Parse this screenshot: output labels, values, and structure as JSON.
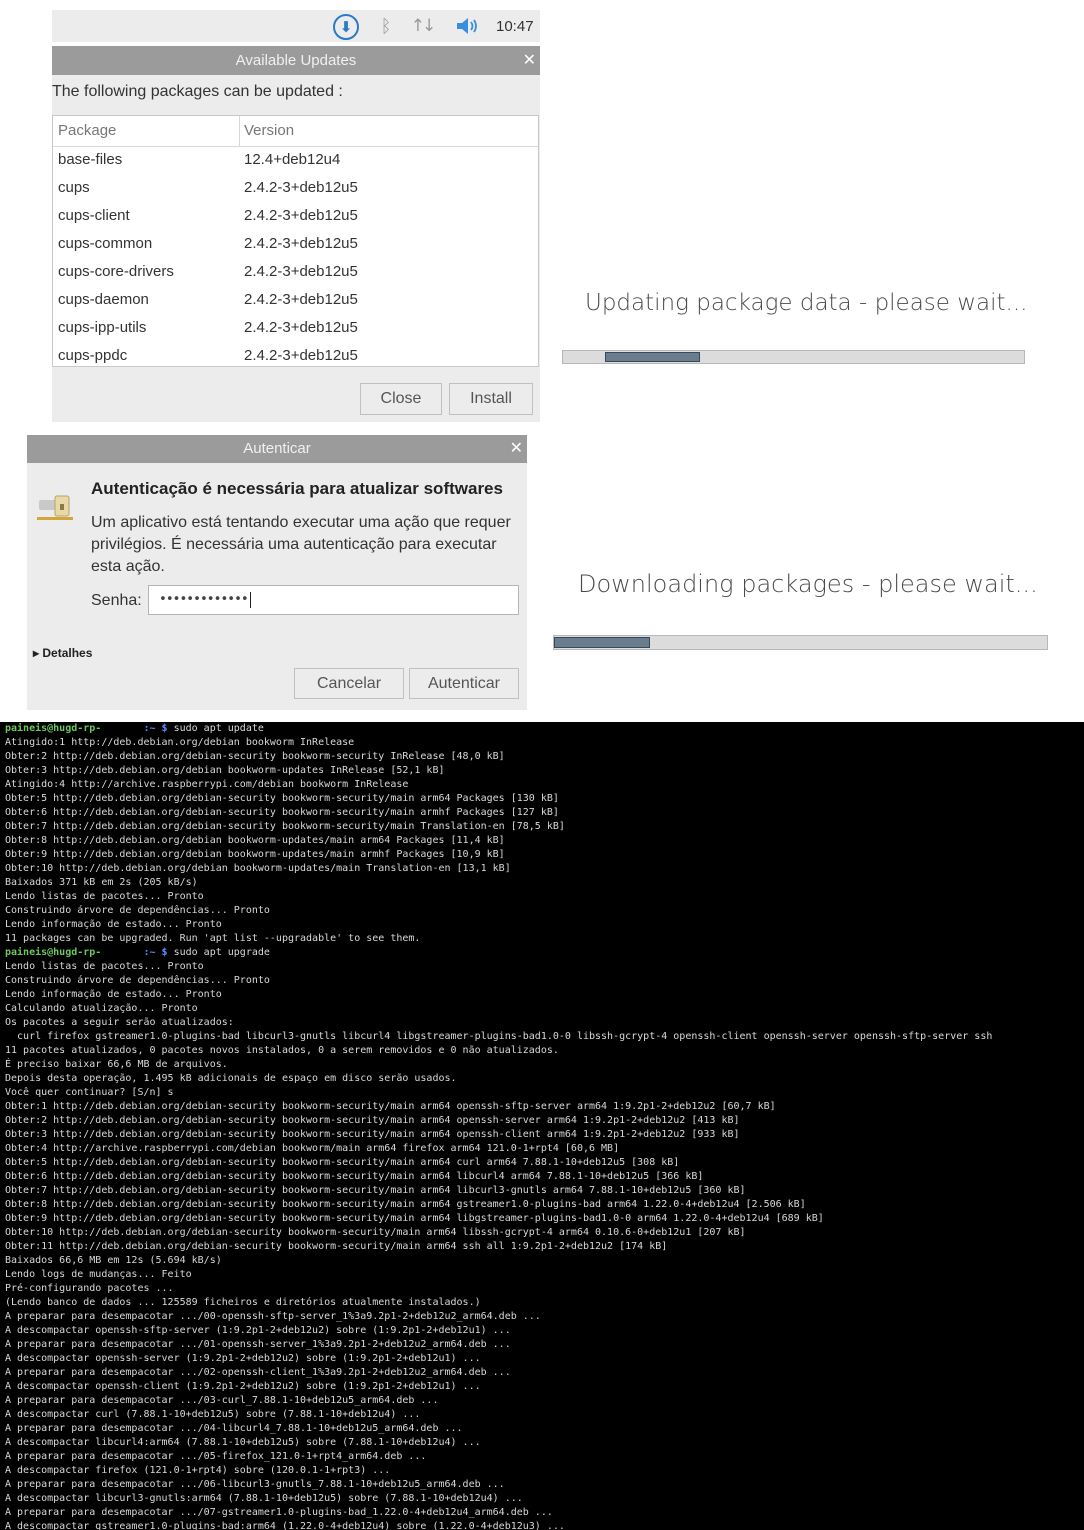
{
  "taskbar": {
    "clock": "10:47",
    "icons": [
      "download-icon",
      "bluetooth-icon",
      "network-icon",
      "volume-icon"
    ]
  },
  "updates_dialog": {
    "title": "Available Updates",
    "intro": "The following packages can be updated :",
    "columns": [
      "Package",
      "Version"
    ],
    "packages": [
      {
        "name": "base-files",
        "version": "12.4+deb12u4"
      },
      {
        "name": "cups",
        "version": "2.4.2-3+deb12u5"
      },
      {
        "name": "cups-client",
        "version": "2.4.2-3+deb12u5"
      },
      {
        "name": "cups-common",
        "version": "2.4.2-3+deb12u5"
      },
      {
        "name": "cups-core-drivers",
        "version": "2.4.2-3+deb12u5"
      },
      {
        "name": "cups-daemon",
        "version": "2.4.2-3+deb12u5"
      },
      {
        "name": "cups-ipp-utils",
        "version": "2.4.2-3+deb12u5"
      },
      {
        "name": "cups-ppdc",
        "version": "2.4.2-3+deb12u5"
      }
    ],
    "close_label": "Close",
    "install_label": "Install"
  },
  "progress_update": {
    "title": "Updating package data - please wait...",
    "indeterminate": true
  },
  "progress_download": {
    "title": "Downloading packages - please wait...",
    "indeterminate": true
  },
  "auth_dialog": {
    "title": "Autenticar",
    "heading": "Autenticação é necessária para atualizar softwares",
    "message": "Um aplicativo está tentando executar uma ação que requer privilégios. É necessária uma autenticação para executar esta ação.",
    "password_label": "Senha:",
    "password_value": "•••••••••••••",
    "details_label": "▸ Detalhes",
    "cancel_label": "Cancelar",
    "auth_label": "Autenticar"
  },
  "terminal": {
    "lines": [
      {
        "user": "paineis@hugd-rp-",
        "path": "       :~ $",
        "cmd": " sudo apt update"
      },
      {
        "text": "Atingido:1 http://deb.debian.org/debian bookworm InRelease"
      },
      {
        "text": "Obter:2 http://deb.debian.org/debian-security bookworm-security InRelease [48,0 kB]"
      },
      {
        "text": "Obter:3 http://deb.debian.org/debian bookworm-updates InRelease [52,1 kB]"
      },
      {
        "text": "Atingido:4 http://archive.raspberrypi.com/debian bookworm InRelease"
      },
      {
        "text": "Obter:5 http://deb.debian.org/debian-security bookworm-security/main arm64 Packages [130 kB]"
      },
      {
        "text": "Obter:6 http://deb.debian.org/debian-security bookworm-security/main armhf Packages [127 kB]"
      },
      {
        "text": "Obter:7 http://deb.debian.org/debian-security bookworm-security/main Translation-en [78,5 kB]"
      },
      {
        "text": "Obter:8 http://deb.debian.org/debian bookworm-updates/main arm64 Packages [11,4 kB]"
      },
      {
        "text": "Obter:9 http://deb.debian.org/debian bookworm-updates/main armhf Packages [10,9 kB]"
      },
      {
        "text": "Obter:10 http://deb.debian.org/debian bookworm-updates/main Translation-en [13,1 kB]"
      },
      {
        "text": "Baixados 371 kB em 2s (205 kB/s)"
      },
      {
        "text": "Lendo listas de pacotes... Pronto"
      },
      {
        "text": "Construindo árvore de dependências... Pronto"
      },
      {
        "text": "Lendo informação de estado... Pronto"
      },
      {
        "text": "11 packages can be upgraded. Run 'apt list --upgradable' to see them."
      },
      {
        "user": "paineis@hugd-rp-",
        "path": "       :~ $",
        "cmd": " sudo apt upgrade"
      },
      {
        "text": "Lendo listas de pacotes... Pronto"
      },
      {
        "text": "Construindo árvore de dependências... Pronto"
      },
      {
        "text": "Lendo informação de estado... Pronto"
      },
      {
        "text": "Calculando atualização... Pronto"
      },
      {
        "text": "Os pacotes a seguir serão atualizados:"
      },
      {
        "text": "  curl firefox gstreamer1.0-plugins-bad libcurl3-gnutls libcurl4 libgstreamer-plugins-bad1.0-0 libssh-gcrypt-4 openssh-client openssh-server openssh-sftp-server ssh"
      },
      {
        "text": "11 pacotes atualizados, 0 pacotes novos instalados, 0 a serem removidos e 0 não atualizados."
      },
      {
        "text": "É preciso baixar 66,6 MB de arquivos."
      },
      {
        "text": "Depois desta operação, 1.495 kB adicionais de espaço em disco serão usados."
      },
      {
        "text": "Você quer continuar? [S/n] s"
      },
      {
        "text": "Obter:1 http://deb.debian.org/debian-security bookworm-security/main arm64 openssh-sftp-server arm64 1:9.2p1-2+deb12u2 [60,7 kB]"
      },
      {
        "text": "Obter:2 http://deb.debian.org/debian-security bookworm-security/main arm64 openssh-server arm64 1:9.2p1-2+deb12u2 [413 kB]"
      },
      {
        "text": "Obter:3 http://deb.debian.org/debian-security bookworm-security/main arm64 openssh-client arm64 1:9.2p1-2+deb12u2 [933 kB]"
      },
      {
        "text": "Obter:4 http://archive.raspberrypi.com/debian bookworm/main arm64 firefox arm64 121.0-1+rpt4 [60,6 MB]"
      },
      {
        "text": "Obter:5 http://deb.debian.org/debian-security bookworm-security/main arm64 curl arm64 7.88.1-10+deb12u5 [308 kB]"
      },
      {
        "text": "Obter:6 http://deb.debian.org/debian-security bookworm-security/main arm64 libcurl4 arm64 7.88.1-10+deb12u5 [366 kB]"
      },
      {
        "text": "Obter:7 http://deb.debian.org/debian-security bookworm-security/main arm64 libcurl3-gnutls arm64 7.88.1-10+deb12u5 [360 kB]"
      },
      {
        "text": "Obter:8 http://deb.debian.org/debian-security bookworm-security/main arm64 gstreamer1.0-plugins-bad arm64 1.22.0-4+deb12u4 [2.506 kB]"
      },
      {
        "text": "Obter:9 http://deb.debian.org/debian-security bookworm-security/main arm64 libgstreamer-plugins-bad1.0-0 arm64 1.22.0-4+deb12u4 [689 kB]"
      },
      {
        "text": "Obter:10 http://deb.debian.org/debian-security bookworm-security/main arm64 libssh-gcrypt-4 arm64 0.10.6-0+deb12u1 [207 kB]"
      },
      {
        "text": "Obter:11 http://deb.debian.org/debian-security bookworm-security/main arm64 ssh all 1:9.2p1-2+deb12u2 [174 kB]"
      },
      {
        "text": "Baixados 66,6 MB em 12s (5.694 kB/s)"
      },
      {
        "text": "Lendo logs de mudanças... Feito"
      },
      {
        "text": "Pré-configurando pacotes ..."
      },
      {
        "text": "(Lendo banco de dados ... 125589 ficheiros e diretórios atualmente instalados.)"
      },
      {
        "text": "A preparar para desempacotar .../00-openssh-sftp-server_1%3a9.2p1-2+deb12u2_arm64.deb ..."
      },
      {
        "text": "A descompactar openssh-sftp-server (1:9.2p1-2+deb12u2) sobre (1:9.2p1-2+deb12u1) ..."
      },
      {
        "text": "A preparar para desempacotar .../01-openssh-server_1%3a9.2p1-2+deb12u2_arm64.deb ..."
      },
      {
        "text": "A descompactar openssh-server (1:9.2p1-2+deb12u2) sobre (1:9.2p1-2+deb12u1) ..."
      },
      {
        "text": "A preparar para desempacotar .../02-openssh-client_1%3a9.2p1-2+deb12u2_arm64.deb ..."
      },
      {
        "text": "A descompactar openssh-client (1:9.2p1-2+deb12u2) sobre (1:9.2p1-2+deb12u1) ..."
      },
      {
        "text": "A preparar para desempacotar .../03-curl_7.88.1-10+deb12u5_arm64.deb ..."
      },
      {
        "text": "A descompactar curl (7.88.1-10+deb12u5) sobre (7.88.1-10+deb12u4) ..."
      },
      {
        "text": "A preparar para desempacotar .../04-libcurl4_7.88.1-10+deb12u5_arm64.deb ..."
      },
      {
        "text": "A descompactar libcurl4:arm64 (7.88.1-10+deb12u5) sobre (7.88.1-10+deb12u4) ..."
      },
      {
        "text": "A preparar para desempacotar .../05-firefox_121.0-1+rpt4_arm64.deb ..."
      },
      {
        "text": "A descompactar firefox (121.0-1+rpt4) sobre (120.0.1-1+rpt3) ..."
      },
      {
        "text": "A preparar para desempacotar .../06-libcurl3-gnutls_7.88.1-10+deb12u5_arm64.deb ..."
      },
      {
        "text": "A descompactar libcurl3-gnutls:arm64 (7.88.1-10+deb12u5) sobre (7.88.1-10+deb12u4) ..."
      },
      {
        "text": "A preparar para desempacotar .../07-gstreamer1.0-plugins-bad_1.22.0-4+deb12u4_arm64.deb ..."
      },
      {
        "text": "A descompactar gstreamer1.0-plugins-bad:arm64 (1.22.0-4+deb12u4) sobre (1.22.0-4+deb12u3) ..."
      }
    ]
  }
}
